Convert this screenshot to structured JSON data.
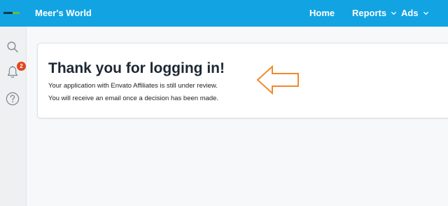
{
  "header": {
    "brand": "Meer's World",
    "nav": {
      "home": "Home",
      "reports": "Reports",
      "ads": "Ads"
    },
    "colors": {
      "bar": "#12a3e3"
    }
  },
  "sidebar": {
    "icons": [
      "search-icon",
      "bell-icon",
      "help-icon"
    ],
    "notification_count": "2",
    "badge_color": "#e2461f"
  },
  "card": {
    "title": "Thank you for logging in!",
    "line1": "Your application with Envato Affiliates is still under review.",
    "line2": "You will receive an email once a decision has been made."
  },
  "annotation": {
    "icon": "arrow-left-icon",
    "color": "#f08a2c"
  }
}
